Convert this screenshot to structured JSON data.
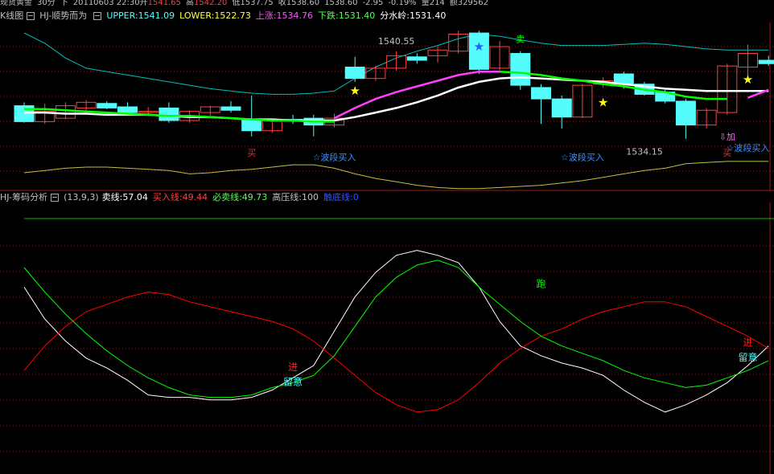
{
  "header": {
    "symbol": "现货黄金",
    "period": "30分",
    "direction": "下",
    "datetime": "20110603 22:30",
    "open_label": "开",
    "open": "1541.65",
    "high_label": "高",
    "high": "1542.20",
    "low_label": "低",
    "low": "1537.75",
    "close_label": "收",
    "close": "1538.60",
    "close2": "1538.60",
    "change": "-2.95",
    "change_pct": "-0.19%",
    "volume_label": "量",
    "volume": "214",
    "amount_label": "额",
    "amount": "329562"
  },
  "panel1": {
    "name": "K线图",
    "indicator": "HJ-顺势而为",
    "upper": "UPPER:1541.09",
    "lower": "LOWER:1522.73",
    "up": "上涨:1534.76",
    "down": "下跌:1531.40",
    "watershed": "分水岭:1531.40"
  },
  "panel2": {
    "name": "HJ-筹码分析",
    "params": "(13,9,3)",
    "sell_line": "卖线:57.04",
    "buy_line": "买入线:49.44",
    "must_sell": "必卖线:49.73",
    "high_pressure": "高压线:100",
    "bottom_line": "触底线:0"
  },
  "colors": {
    "up_candle": "#ff4040",
    "down_candle": "#54fcfc",
    "upper_band": "#00c0c0",
    "lower_band": "#c0c040",
    "watershed": "#ffffff",
    "up_line": "#ff40ff",
    "down_line": "#00ff00",
    "osc_white": "#ffffff",
    "osc_red": "#ff0000",
    "osc_green": "#00ff00"
  },
  "chart_data": [
    {
      "type": "candlestick",
      "title": "K线图 HJ-顺势而为",
      "ylim": [
        1530.5,
        1544.5
      ],
      "candles": [
        {
          "o": 1537.6,
          "h": 1537.9,
          "l": 1536.1,
          "c": 1536.2
        },
        {
          "o": 1536.2,
          "h": 1537.8,
          "l": 1536.0,
          "c": 1537.1
        },
        {
          "o": 1536.5,
          "h": 1537.9,
          "l": 1536.4,
          "c": 1537.6
        },
        {
          "o": 1537.4,
          "h": 1538.1,
          "l": 1537.0,
          "c": 1537.9
        },
        {
          "o": 1537.8,
          "h": 1538.0,
          "l": 1537.3,
          "c": 1537.4
        },
        {
          "o": 1537.5,
          "h": 1537.9,
          "l": 1536.9,
          "c": 1537.0
        },
        {
          "o": 1537.0,
          "h": 1537.5,
          "l": 1536.7,
          "c": 1537.1
        },
        {
          "o": 1537.4,
          "h": 1537.9,
          "l": 1536.1,
          "c": 1536.3
        },
        {
          "o": 1536.3,
          "h": 1537.2,
          "l": 1536.1,
          "c": 1537.1
        },
        {
          "o": 1537.0,
          "h": 1537.6,
          "l": 1536.7,
          "c": 1537.5
        },
        {
          "o": 1537.5,
          "h": 1538.0,
          "l": 1537.0,
          "c": 1537.2
        },
        {
          "o": 1536.4,
          "h": 1538.5,
          "l": 1534.9,
          "c": 1535.4
        },
        {
          "o": 1535.4,
          "h": 1536.4,
          "l": 1535.2,
          "c": 1536.3
        },
        {
          "o": 1536.4,
          "h": 1536.8,
          "l": 1536.0,
          "c": 1536.3
        },
        {
          "o": 1536.5,
          "h": 1536.8,
          "l": 1534.9,
          "c": 1535.9
        },
        {
          "o": 1535.9,
          "h": 1536.9,
          "l": 1535.7,
          "c": 1536.5
        },
        {
          "o": 1541.0,
          "h": 1541.9,
          "l": 1539.7,
          "c": 1540.0
        },
        {
          "o": 1540.0,
          "h": 1541.1,
          "l": 1539.8,
          "c": 1540.9
        },
        {
          "o": 1540.9,
          "h": 1542.4,
          "l": 1540.7,
          "c": 1542.0
        },
        {
          "o": 1541.9,
          "h": 1542.2,
          "l": 1541.3,
          "c": 1541.6
        },
        {
          "o": 1542.0,
          "h": 1542.8,
          "l": 1541.4,
          "c": 1542.5
        },
        {
          "o": 1542.4,
          "h": 1544.2,
          "l": 1542.2,
          "c": 1543.9
        },
        {
          "o": 1544.0,
          "h": 1544.2,
          "l": 1540.4,
          "c": 1540.8
        },
        {
          "o": 1540.9,
          "h": 1543.3,
          "l": 1540.7,
          "c": 1542.8
        },
        {
          "o": 1542.2,
          "h": 1542.4,
          "l": 1539.0,
          "c": 1539.4
        },
        {
          "o": 1539.2,
          "h": 1539.5,
          "l": 1536.0,
          "c": 1538.2
        },
        {
          "o": 1538.2,
          "h": 1538.5,
          "l": 1535.6,
          "c": 1536.6
        },
        {
          "o": 1536.6,
          "h": 1539.5,
          "l": 1536.5,
          "c": 1539.4
        },
        {
          "o": 1539.5,
          "h": 1540.1,
          "l": 1539.2,
          "c": 1539.8
        },
        {
          "o": 1540.4,
          "h": 1540.6,
          "l": 1539.1,
          "c": 1539.5
        },
        {
          "o": 1539.5,
          "h": 1539.7,
          "l": 1538.5,
          "c": 1538.6
        },
        {
          "o": 1538.8,
          "h": 1539.0,
          "l": 1537.8,
          "c": 1538.0
        },
        {
          "o": 1538.0,
          "h": 1538.2,
          "l": 1534.7,
          "c": 1535.9
        },
        {
          "o": 1535.9,
          "h": 1537.4,
          "l": 1535.6,
          "c": 1537.2
        },
        {
          "o": 1537.0,
          "h": 1541.3,
          "l": 1536.8,
          "c": 1541.1
        },
        {
          "o": 1541.0,
          "h": 1543.0,
          "l": 1540.2,
          "c": 1542.2
        },
        {
          "o": 1541.6,
          "h": 1542.0,
          "l": 1541.1,
          "c": 1541.3
        }
      ],
      "upper": [
        1544.0,
        1543.1,
        1541.8,
        1540.9,
        1540.6,
        1540.3,
        1540.0,
        1539.7,
        1539.4,
        1539.1,
        1538.9,
        1538.7,
        1538.6,
        1538.6,
        1538.7,
        1538.9,
        1540.0,
        1541.0,
        1541.8,
        1542.4,
        1542.9,
        1543.5,
        1543.9,
        1543.7,
        1543.4,
        1543.1,
        1542.9,
        1542.9,
        1542.9,
        1543.0,
        1543.1,
        1543.0,
        1542.8,
        1542.6,
        1542.5,
        1542.5,
        1542.5
      ],
      "lower": [
        1531.7,
        1531.9,
        1532.1,
        1532.2,
        1532.2,
        1532.1,
        1532.0,
        1531.9,
        1531.6,
        1531.7,
        1531.9,
        1532.0,
        1532.2,
        1532.4,
        1532.4,
        1532.1,
        1531.6,
        1531.2,
        1530.9,
        1530.6,
        1530.4,
        1530.3,
        1530.3,
        1530.4,
        1530.5,
        1530.6,
        1530.8,
        1531.0,
        1531.3,
        1531.6,
        1531.9,
        1532.1,
        1532.5,
        1532.6,
        1532.7,
        1532.7,
        1532.7
      ],
      "watershed": [
        1537.0,
        1537.0,
        1536.9,
        1536.9,
        1536.8,
        1536.8,
        1536.8,
        1536.7,
        1536.6,
        1536.6,
        1536.5,
        1536.4,
        1536.4,
        1536.3,
        1536.3,
        1536.3,
        1536.6,
        1537.0,
        1537.4,
        1537.9,
        1538.5,
        1539.2,
        1539.7,
        1540.0,
        1540.1,
        1540.0,
        1539.9,
        1539.8,
        1539.7,
        1539.5,
        1539.3,
        1539.1,
        1539.0,
        1538.9,
        1538.9,
        1538.9,
        1538.9
      ],
      "up_line": [
        null,
        null,
        null,
        null,
        null,
        null,
        null,
        null,
        null,
        null,
        null,
        null,
        null,
        null,
        null,
        1536.5,
        1537.4,
        1538.2,
        1538.8,
        1539.3,
        1539.8,
        1540.3,
        1540.6,
        1540.6,
        null,
        null,
        null,
        null,
        null,
        null,
        null,
        null,
        null,
        null,
        null,
        1538.3,
        1539.0
      ],
      "down_line": [
        1537.3,
        1537.3,
        1537.2,
        1537.1,
        1537.0,
        1536.9,
        1536.8,
        1536.7,
        1536.7,
        1536.6,
        1536.5,
        1536.4,
        1536.3,
        1536.3,
        1536.2,
        1536.2,
        null,
        null,
        null,
        null,
        null,
        null,
        null,
        1540.6,
        1540.5,
        1540.3,
        1540.0,
        1539.8,
        1539.5,
        1539.3,
        1539.0,
        1538.8,
        1538.4,
        1538.2,
        1538.2,
        null,
        null
      ],
      "annotations": [
        {
          "text": "1540.55",
          "i": 18,
          "price": 1543.0,
          "color": "#c0c0c0"
        },
        {
          "text": "1534.15",
          "i": 30,
          "price": 1533.3,
          "color": "#c0c0c0"
        },
        {
          "text": "卖",
          "i": 24,
          "price": 1543.2,
          "color": "#00ff00"
        },
        {
          "text": "买",
          "i": 11,
          "price": 1533.2,
          "color": "#ff2020"
        },
        {
          "text": "买",
          "i": 34,
          "price": 1533.2,
          "color": "#ff2020"
        },
        {
          "text": "☆波段买入",
          "i": 15,
          "price": 1532.8,
          "color": "#3f8fff"
        },
        {
          "text": "☆波段买入",
          "i": 27,
          "price": 1532.8,
          "color": "#3f8fff"
        },
        {
          "text": "☆波段买入",
          "i": 35,
          "price": 1533.6,
          "color": "#3f8fff"
        },
        {
          "text": "⇩加",
          "i": 34,
          "price": 1534.6,
          "color": "#ff60ff"
        }
      ],
      "stars": [
        {
          "i": 16,
          "price": 1538.9,
          "color": "#ffff00"
        },
        {
          "i": 28,
          "price": 1537.9,
          "color": "#ffff00"
        },
        {
          "i": 35,
          "price": 1539.9,
          "color": "#ffff00"
        },
        {
          "i": 22,
          "price": 1542.8,
          "color": "#2060ff"
        }
      ]
    },
    {
      "type": "line",
      "title": "HJ-筹码分析",
      "ylim": [
        0,
        100
      ],
      "x": [
        0,
        1,
        2,
        3,
        4,
        5,
        6,
        7,
        8,
        9,
        10,
        11,
        12,
        13,
        14,
        15,
        16,
        17,
        18,
        19,
        20,
        21,
        22,
        23,
        24,
        25,
        26,
        27,
        28,
        29,
        30,
        31,
        32,
        33,
        34,
        35,
        36
      ],
      "series": [
        {
          "name": "卖线",
          "color": "#ffffff",
          "values": [
            72,
            59,
            50,
            43,
            39,
            34,
            28,
            27,
            27,
            26,
            26,
            27,
            30,
            35,
            40,
            54,
            68,
            78,
            85,
            87,
            85,
            82,
            72,
            58,
            48,
            44,
            41,
            39,
            36,
            30,
            25,
            21,
            24,
            28,
            33,
            40,
            48
          ]
        },
        {
          "name": "买入线",
          "color": "#ff0000",
          "values": [
            38,
            48,
            56,
            62,
            65,
            68,
            70,
            69,
            66,
            64,
            62,
            60,
            58,
            55,
            50,
            43,
            36,
            29,
            24,
            21,
            22,
            26,
            33,
            41,
            47,
            52,
            55,
            59,
            62,
            64,
            66,
            66,
            64,
            60,
            56,
            52,
            47
          ]
        },
        {
          "name": "必卖线",
          "color": "#00ff00",
          "values": [
            80,
            70,
            61,
            53,
            46,
            40,
            35,
            31,
            28,
            27,
            27,
            28,
            31,
            33,
            36,
            44,
            56,
            68,
            76,
            81,
            83,
            80,
            72,
            65,
            58,
            52,
            48,
            45,
            42,
            38,
            35,
            33,
            31,
            32,
            35,
            38,
            42
          ]
        }
      ],
      "reference_lines": [
        {
          "name": "高压线",
          "value": 100,
          "color": "#00c000"
        }
      ],
      "annotations": [
        {
          "text": "进",
          "i": 13,
          "value": 38,
          "color": "#ff2020"
        },
        {
          "text": "留意",
          "i": 13,
          "value": 32,
          "color": "#40ffff"
        },
        {
          "text": "跑",
          "i": 25,
          "value": 72,
          "color": "#00ff00"
        },
        {
          "text": "进",
          "i": 35,
          "value": 48,
          "color": "#ff2020"
        },
        {
          "text": "留意",
          "i": 35,
          "value": 42,
          "color": "#40ffff"
        }
      ]
    }
  ]
}
